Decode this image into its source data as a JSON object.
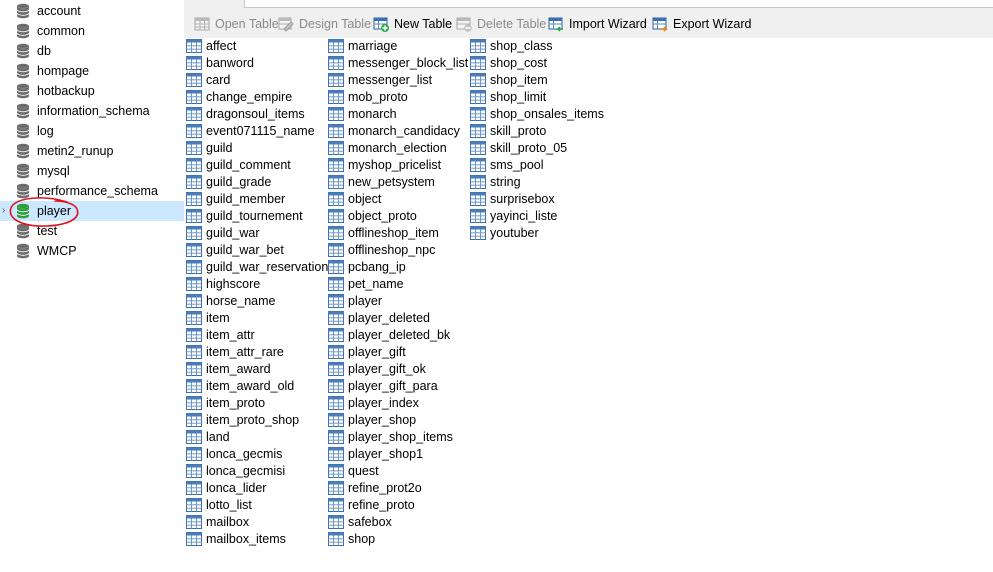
{
  "sidebar": {
    "databases": [
      {
        "label": "account",
        "selected": false
      },
      {
        "label": "common",
        "selected": false
      },
      {
        "label": "db",
        "selected": false
      },
      {
        "label": "hompage",
        "selected": false
      },
      {
        "label": "hotbackup",
        "selected": false
      },
      {
        "label": "information_schema",
        "selected": false
      },
      {
        "label": "log",
        "selected": false
      },
      {
        "label": "metin2_runup",
        "selected": false
      },
      {
        "label": "mysql",
        "selected": false
      },
      {
        "label": "performance_schema",
        "selected": false
      },
      {
        "label": "player",
        "selected": true
      },
      {
        "label": "test",
        "selected": false
      },
      {
        "label": "WMCP",
        "selected": false
      }
    ],
    "selected_chevron": "›"
  },
  "toolbar": {
    "open_table": "Open Table",
    "design_table": "Design Table",
    "new_table": "New Table",
    "delete_table": "Delete Table",
    "import_wizard": "Import Wizard",
    "export_wizard": "Export Wizard"
  },
  "colors": {
    "selection": "#cce8ff",
    "db_icon_gray": "#6d6d6d",
    "db_icon_active": "#2e9e3e",
    "table_icon_blue": "#4a7ebb",
    "annotation_red": "#e0141e"
  },
  "icons": {
    "database": "database-icon",
    "table": "table-grid-icon",
    "new_table": "table-add-icon",
    "delete_table": "table-delete-icon",
    "import": "import-wizard-icon",
    "export": "export-wizard-icon"
  },
  "tables": {
    "column1": [
      "affect",
      "banword",
      "card",
      "change_empire",
      "dragonsoul_items",
      "event071115_name",
      "guild",
      "guild_comment",
      "guild_grade",
      "guild_member",
      "guild_tournement",
      "guild_war",
      "guild_war_bet",
      "guild_war_reservation",
      "highscore",
      "horse_name",
      "item",
      "item_attr",
      "item_attr_rare",
      "item_award",
      "item_award_old",
      "item_proto",
      "item_proto_shop",
      "land",
      "lonca_gecmis",
      "lonca_gecmisi",
      "lonca_lider",
      "lotto_list",
      "mailbox",
      "mailbox_items"
    ],
    "column2": [
      "marriage",
      "messenger_block_list",
      "messenger_list",
      "mob_proto",
      "monarch",
      "monarch_candidacy",
      "monarch_election",
      "myshop_pricelist",
      "new_petsystem",
      "object",
      "object_proto",
      "offlineshop_item",
      "offlineshop_npc",
      "pcbang_ip",
      "pet_name",
      "player",
      "player_deleted",
      "player_deleted_bk",
      "player_gift",
      "player_gift_ok",
      "player_gift_para",
      "player_index",
      "player_shop",
      "player_shop_items",
      "player_shop1",
      "quest",
      "refine_prot2o",
      "refine_proto",
      "safebox",
      "shop"
    ],
    "column3": [
      "shop_class",
      "shop_cost",
      "shop_item",
      "shop_limit",
      "shop_onsales_items",
      "skill_proto",
      "skill_proto_05",
      "sms_pool",
      "string",
      "surprisebox",
      "yayinci_liste",
      "youtuber"
    ]
  }
}
